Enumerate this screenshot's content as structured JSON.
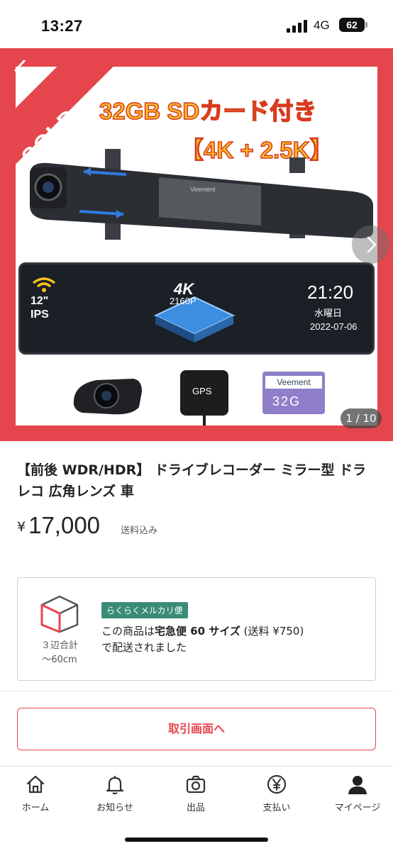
{
  "status_bar": {
    "time": "13:27",
    "network": "4G",
    "battery": "62"
  },
  "image": {
    "sold_label": "SOLD",
    "counter": "1 / 10",
    "promo_line1": "32GB SDカード付き",
    "promo_line2": "【4K + 2.5K】",
    "display_size": "12\"",
    "display_panel": "IPS",
    "display_4k": "4K",
    "display_resolution": "2160P",
    "display_time": "21:20",
    "display_day": "水曜日",
    "display_date": "2022-07-06",
    "gps_label": "GPS",
    "sd_brand": "Veement",
    "sd_capacity": "32G"
  },
  "product": {
    "title": "【前後 WDR/HDR】 ドライブレコーダー ミラー型 ドラレコ 広角レンズ 車",
    "currency": "¥",
    "price": "17,000",
    "shipping_included": "送料込み"
  },
  "shipping": {
    "size_label_line1": "３辺合計",
    "size_label_line2": "〜60cm",
    "badge": "らくらくメルカリ便",
    "text_prefix": "この商品は",
    "method": "宅急便 60 サイズ",
    "fee": " (送料 ¥750)",
    "text_suffix": "で配送されました"
  },
  "actions": {
    "trade_screen": "取引画面へ"
  },
  "nav": {
    "home": "ホーム",
    "notifications": "お知らせ",
    "sell": "出品",
    "payment": "支払い",
    "mypage": "マイページ"
  },
  "colors": {
    "accent": "#e5454c",
    "rakuraku_badge": "#3a8c78",
    "promo_text": "#f6bf2a"
  }
}
